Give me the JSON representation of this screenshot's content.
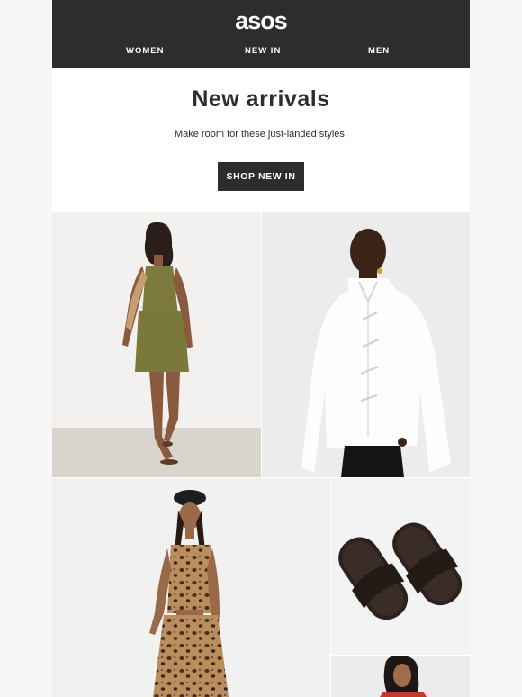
{
  "brand": {
    "logo_text": "asos"
  },
  "nav": {
    "items": [
      "WOMEN",
      "NEW IN",
      "MEN"
    ]
  },
  "hero": {
    "title": "New arrivals",
    "subtitle": "Make room for these just-landed styles.",
    "cta_label": "SHOP NEW IN"
  },
  "colors": {
    "header_bg": "#2d2d2d",
    "page_bg": "#f6f6f6",
    "button_bg": "#2d2d2d",
    "text": "#2d2d2d"
  }
}
